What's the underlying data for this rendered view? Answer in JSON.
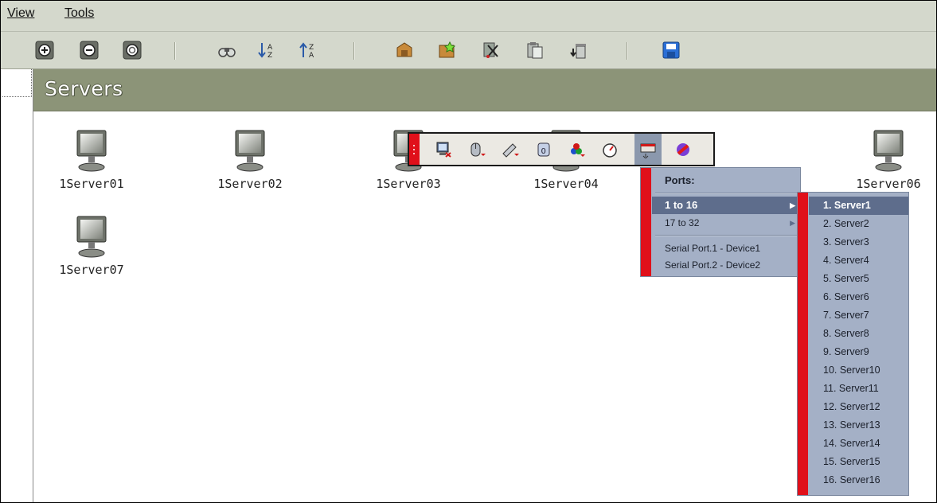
{
  "menubar": {
    "items": [
      {
        "label": "View"
      },
      {
        "label": "Tools"
      }
    ]
  },
  "toolbar": {
    "buttons": [
      {
        "icon": "zoom-in-icon"
      },
      {
        "icon": "zoom-out-icon"
      },
      {
        "icon": "zoom-reset-icon"
      },
      {
        "icon": "find-binoculars-icon"
      },
      {
        "icon": "sort-ascending-icon"
      },
      {
        "icon": "sort-descending-icon"
      },
      {
        "icon": "connect-icon"
      },
      {
        "icon": "new-item-icon"
      },
      {
        "icon": "cut-icon"
      },
      {
        "icon": "paste-icon"
      },
      {
        "icon": "delete-icon"
      },
      {
        "icon": "save-icon"
      }
    ]
  },
  "header": {
    "title": "Servers"
  },
  "servers": [
    {
      "label": "1Server01"
    },
    {
      "label": "1Server02"
    },
    {
      "label": "1Server03"
    },
    {
      "label": "1Server04"
    },
    {
      "label": "1Server06"
    },
    {
      "label": "1Server07"
    }
  ],
  "popup_toolbar": {
    "buttons": [
      {
        "icon": "disconnect-session-icon"
      },
      {
        "icon": "mouse-options-icon"
      },
      {
        "icon": "keyboard-macros-icon"
      },
      {
        "icon": "video-settings-icon"
      },
      {
        "icon": "color-depth-icon"
      },
      {
        "icon": "performance-gauge-icon"
      },
      {
        "icon": "port-select-icon"
      },
      {
        "icon": "exit-icon"
      }
    ]
  },
  "ports_menu": {
    "title": "Ports:",
    "items": [
      {
        "label": "1 to 16",
        "has_submenu": true,
        "active": true
      },
      {
        "label": "17 to 32",
        "has_submenu": true,
        "active": false
      }
    ],
    "serial": [
      {
        "label": "Serial Port.1 - Device1"
      },
      {
        "label": "Serial Port.2 - Device2"
      }
    ]
  },
  "servers_submenu": {
    "items": [
      {
        "label": "1. Server1"
      },
      {
        "label": "2. Server2"
      },
      {
        "label": "3. Server3"
      },
      {
        "label": "4. Server4"
      },
      {
        "label": "5. Server5"
      },
      {
        "label": "6. Server6"
      },
      {
        "label": "7. Server7"
      },
      {
        "label": "8. Server8"
      },
      {
        "label": "9. Server9"
      },
      {
        "label": "10. Server10"
      },
      {
        "label": "11. Server11"
      },
      {
        "label": "12. Server12"
      },
      {
        "label": "13. Server13"
      },
      {
        "label": "14. Server14"
      },
      {
        "label": "15. Server15"
      },
      {
        "label": "16. Server16"
      }
    ],
    "active_index": 0
  },
  "colors": {
    "menu_bg": "#d4d8cc",
    "header_bg": "#8c9478",
    "menu_panel": "#a4b0c6",
    "menu_highlight": "#5e6d8c",
    "accent_strip": "#e0101a"
  }
}
